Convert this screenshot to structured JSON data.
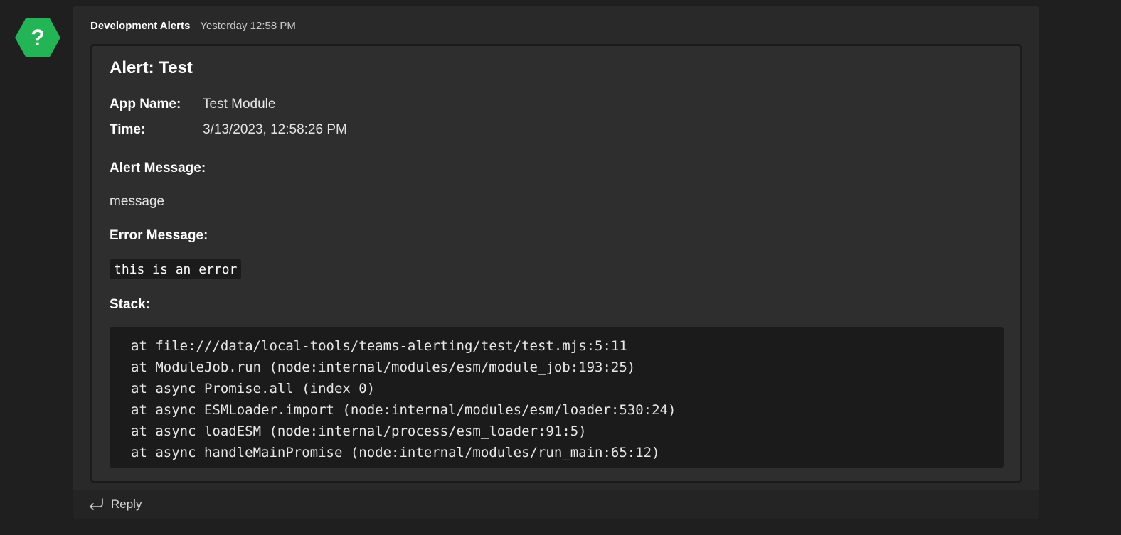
{
  "avatar": {
    "glyph": "?",
    "color": "#22b455",
    "icon": "help-hexagon-icon"
  },
  "message": {
    "sender": "Development Alerts",
    "timestamp": "Yesterday 12:58 PM"
  },
  "card": {
    "title": "Alert: Test",
    "facts": [
      {
        "key": "App Name:",
        "value": "Test Module"
      },
      {
        "key": "Time:",
        "value": "3/13/2023, 12:58:26 PM"
      }
    ],
    "alert_message_label": "Alert Message:",
    "alert_message": "message",
    "error_message_label": "Error Message:",
    "error_message": "this is an error",
    "stack_label": "Stack:",
    "stack_lines": [
      "at file:///data/local-tools/teams-alerting/test/test.mjs:5:11",
      "at ModuleJob.run (node:internal/modules/esm/module_job:193:25)",
      "at async Promise.all (index 0)",
      "at async ESMLoader.import (node:internal/modules/esm/loader:530:24)",
      "at async loadESM (node:internal/process/esm_loader:91:5)",
      "at async handleMainPromise (node:internal/modules/run_main:65:12)"
    ]
  },
  "reply": {
    "label": "Reply",
    "icon": "reply-arrow-icon"
  },
  "colors": {
    "page_background": "#1f1f1f",
    "message_background": "#292929",
    "card_background": "#2e2e2e",
    "code_background": "#1b1b1b",
    "reply_bar_background": "#242424"
  }
}
